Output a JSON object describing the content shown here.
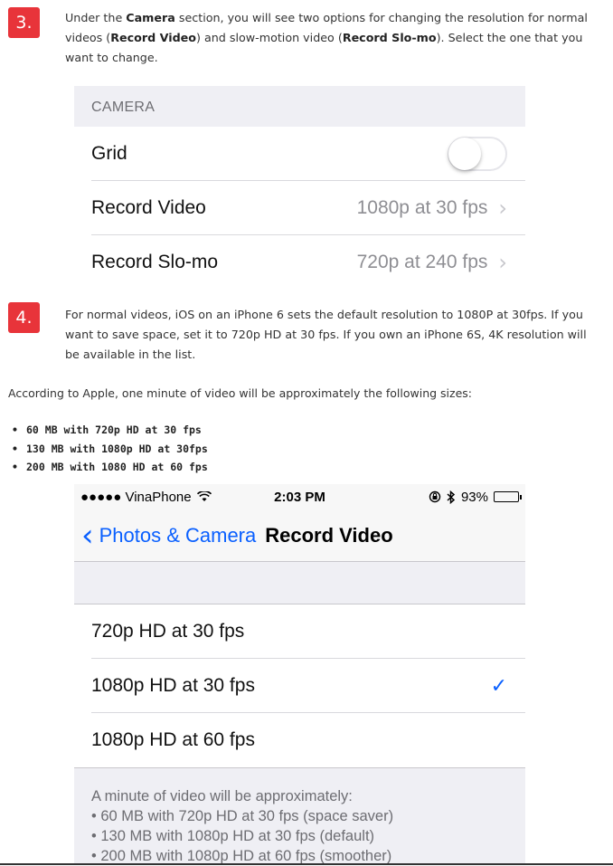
{
  "step3": {
    "number": "3.",
    "text_pre": "Under the ",
    "text_camera": "Camera",
    "text_mid1": " section, you will see two options for changing the resolution for normal videos (",
    "text_record_video": "Record Video",
    "text_mid2": ") and slow-motion video (",
    "text_record_slomo": "Record Slo-mo",
    "text_post": "). Select the one that you want to change."
  },
  "camera_screen": {
    "section_header": "CAMERA",
    "rows": [
      {
        "label": "Grid",
        "type": "toggle",
        "on": false
      },
      {
        "label": "Record Video",
        "value": "1080p at 30 fps"
      },
      {
        "label": "Record Slo-mo",
        "value": "720p at 240 fps"
      }
    ]
  },
  "step4": {
    "number": "4.",
    "text": "For normal videos, iOS on an iPhone 6 sets the default resolution to 1080P at 30fps. If you want to save space, set it to 720p HD at 30 fps. If you own an iPhone 6S, 4K resolution will be available in the list."
  },
  "paragraph": "According to Apple, one minute of video will be approximately the following sizes:",
  "sizes": [
    "60 MB with 720p HD at 30 fps",
    "130 MB with 1080p HD at 30fps",
    "200 MB with 1080 HD at 60 fps"
  ],
  "record_screen": {
    "status": {
      "carrier": "●●●●● VinaPhone",
      "time": "2:03 PM",
      "battery": "93%"
    },
    "nav": {
      "back_label": "Photos & Camera",
      "title": "Record Video"
    },
    "options": [
      {
        "label": "720p HD at 30 fps",
        "selected": false
      },
      {
        "label": "1080p HD at 30 fps",
        "selected": true
      },
      {
        "label": "1080p HD at 60 fps",
        "selected": false
      }
    ],
    "footer": [
      "A minute of video will be approximately:",
      "• 60 MB with 720p HD at 30 fps (space saver)",
      "• 130 MB with 1080p HD at 30 fps (default)",
      "• 200 MB with 1080p HD at 60 fps (smoother)"
    ]
  },
  "colors": {
    "step_badge": "#e8343a",
    "ios_blue": "#0a60ff",
    "ios_group_bg": "#efeff4"
  },
  "icons": {
    "wifi": "wifi-icon",
    "bluetooth": "bluetooth-icon",
    "orientation_lock": "orientation-lock-icon"
  }
}
